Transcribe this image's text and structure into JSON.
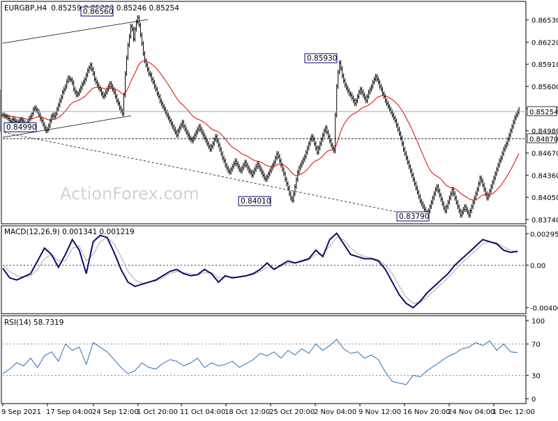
{
  "header": {
    "symbol": "EURGBP,H4",
    "ohlc": "0.85259 0.85303 0.85246 0.85254"
  },
  "watermark": "ActionForex.com",
  "colors": {
    "background": "#ffffff",
    "frame": "#000000",
    "price": "#000000",
    "ma": "#dd0000",
    "macd_main": "#0a0a6e",
    "macd_signal": "#a8a8a8",
    "rsi": "#2b6fb5",
    "label_box": "#000080",
    "watermark": "#d2d2d2"
  },
  "chart_data": [
    {
      "type": "line",
      "name": "price-panel",
      "series_note": "H4 bar chart with moving average",
      "x_labels": [
        "9 Sep 2021",
        "17 Sep 04:00",
        "24 Sep 12:00",
        "1 Oct 20:00",
        "11 Oct 04:00",
        "18 Oct 12:00",
        "25 Oct 20:00",
        "2 Nov 04:00",
        "9 Nov 12:00",
        "16 Nov 20:00",
        "24 Nov 04:00",
        "1 Dec 12:00"
      ],
      "y_ticks": [
        "0.86530",
        "0.86220",
        "0.85910",
        "0.85600",
        "0.85290",
        "0.84980",
        "0.84670",
        "0.84360",
        "0.84050",
        "0.83740"
      ],
      "ylim": [
        0.837,
        0.8675
      ],
      "price_x": [
        0.0,
        2,
        4,
        6,
        8,
        10,
        12,
        14,
        16,
        18,
        20,
        22,
        24,
        26,
        28,
        30,
        32,
        34,
        36,
        38,
        40,
        42,
        44,
        46,
        48,
        50,
        52,
        54,
        56,
        58,
        60,
        62,
        64,
        66,
        68,
        70,
        72,
        74,
        76,
        78,
        80,
        82,
        84,
        86,
        88,
        90,
        92,
        94,
        96,
        98,
        100,
        102,
        104,
        106,
        108,
        110,
        112,
        114,
        116,
        118,
        120,
        122,
        124,
        126,
        128,
        130,
        132,
        134,
        136,
        138,
        140,
        142,
        144,
        146,
        148,
        150,
        152,
        154,
        156,
        158,
        160,
        162,
        164,
        166,
        168,
        170,
        172,
        174,
        176,
        178,
        180,
        182,
        184,
        186,
        188,
        190,
        192,
        194,
        196,
        198,
        200,
        202,
        204,
        206,
        208,
        210,
        212,
        214,
        216,
        218,
        220,
        222,
        224,
        226,
        228,
        230,
        232,
        234,
        236,
        238,
        240,
        242,
        244,
        246,
        248,
        250,
        252,
        254,
        256,
        258,
        260,
        262,
        264,
        266,
        268,
        270,
        272,
        274,
        276,
        278,
        280,
        282,
        284,
        286,
        288,
        290,
        292,
        294,
        296,
        298,
        300,
        302,
        304,
        306,
        308,
        310,
        312,
        314,
        316,
        318,
        320,
        322,
        324,
        326,
        328,
        330,
        332,
        334,
        336,
        338,
        340,
        342,
        344,
        346,
        348,
        350,
        352,
        354,
        356,
        358,
        360,
        362,
        364,
        366,
        368,
        370,
        372,
        374,
        376,
        378,
        380,
        382,
        384,
        386,
        388,
        390,
        392,
        394,
        396,
        398,
        400,
        402,
        404,
        406,
        408,
        410,
        412,
        414,
        416,
        418,
        420,
        422,
        424,
        426,
        428,
        430,
        432,
        434,
        436,
        438,
        440,
        442,
        444,
        446,
        448,
        450,
        452,
        454,
        456,
        458,
        460,
        462,
        464,
        466,
        468,
        470,
        472,
        474,
        476,
        478,
        480,
        482,
        484,
        486,
        488,
        490,
        492,
        494,
        496,
        498,
        500,
        502,
        504,
        506,
        508,
        510,
        512,
        514,
        516,
        518,
        520,
        522,
        524,
        526,
        528,
        530,
        532,
        534,
        536,
        538,
        540,
        542,
        544,
        546,
        548,
        550,
        552,
        554,
        556,
        558,
        560,
        562,
        564,
        566,
        568,
        570,
        572,
        574,
        576,
        578,
        580,
        582,
        584,
        586,
        588,
        590,
        592,
        594,
        596,
        598,
        600,
        602,
        604,
        606,
        608,
        610,
        612,
        614,
        616,
        618,
        620,
        622,
        624,
        626,
        628,
        630,
        632,
        634,
        636,
        638,
        640,
        642,
        644,
        646,
        648,
        650,
        652,
        654,
        656,
        658,
        660,
        662,
        664,
        666,
        668,
        670,
        672,
        674,
        676,
        678,
        680,
        682,
        684,
        686,
        688,
        690,
        692,
        694,
        696,
        698,
        700,
        702,
        704,
        706,
        708,
        710,
        712,
        714,
        716,
        718,
        720,
        722,
        724,
        726,
        728,
        730,
        732,
        734,
        736,
        738,
        740,
        742
      ],
      "price_note": "x values in bar-index units (0-742); mapped to pixels by script",
      "close": [
        0.852,
        0.8519,
        0.8518,
        0.8517,
        0.8515,
        0.8512,
        0.851,
        0.8514,
        0.8513,
        0.8511,
        0.8508,
        0.851,
        0.8512,
        0.8514,
        0.8512,
        0.8509,
        0.8507,
        0.8503,
        0.851,
        0.8515,
        0.8518,
        0.8522,
        0.8528,
        0.853,
        0.8527,
        0.8525,
        0.852,
        0.8515,
        0.8512,
        0.8507,
        0.8502,
        0.8498,
        0.85,
        0.8505,
        0.8512,
        0.8518,
        0.852,
        0.8518,
        0.8522,
        0.8528,
        0.8534,
        0.854,
        0.8545,
        0.8552,
        0.8556,
        0.856,
        0.8567,
        0.8572,
        0.857,
        0.8569,
        0.8565,
        0.8556,
        0.8552,
        0.8548,
        0.855,
        0.8554,
        0.8558,
        0.8563,
        0.8566,
        0.857,
        0.8576,
        0.8582,
        0.8586,
        0.859,
        0.8584,
        0.8578,
        0.857,
        0.8566,
        0.8562,
        0.8558,
        0.8555,
        0.855,
        0.8546,
        0.8548,
        0.8552,
        0.8556,
        0.856,
        0.8564,
        0.856,
        0.8556,
        0.8552,
        0.8546,
        0.854,
        0.8536,
        0.853,
        0.8526,
        0.8522,
        0.8548,
        0.8578,
        0.86,
        0.8618,
        0.863,
        0.8644,
        0.864,
        0.8626,
        0.864,
        0.865,
        0.8656,
        0.8646,
        0.8632,
        0.862,
        0.8606,
        0.8596,
        0.859,
        0.8584,
        0.8578,
        0.8576,
        0.857,
        0.8566,
        0.856,
        0.8556,
        0.855,
        0.8546,
        0.854,
        0.8536,
        0.8532,
        0.8528,
        0.8524,
        0.852,
        0.8516,
        0.8512,
        0.8508,
        0.8504,
        0.85,
        0.8496,
        0.8492,
        0.8498,
        0.8502,
        0.8506,
        0.851,
        0.8504,
        0.85,
        0.8496,
        0.8492,
        0.8488,
        0.8486,
        0.8484,
        0.8488,
        0.8492,
        0.8496,
        0.85,
        0.8504,
        0.85,
        0.8496,
        0.8492,
        0.8488,
        0.8484,
        0.848,
        0.8476,
        0.8472,
        0.8476,
        0.848,
        0.8486,
        0.849,
        0.8484,
        0.8478,
        0.8472,
        0.8466,
        0.846,
        0.8456,
        0.845,
        0.8446,
        0.8442,
        0.844,
        0.8444,
        0.8448,
        0.8452,
        0.8456,
        0.8452,
        0.8448,
        0.8444,
        0.8442,
        0.8446,
        0.845,
        0.8454,
        0.845,
        0.8446,
        0.8442,
        0.844,
        0.8436,
        0.844,
        0.8444,
        0.8448,
        0.8452,
        0.8448,
        0.8444,
        0.844,
        0.8436,
        0.8432,
        0.843,
        0.8434,
        0.8438,
        0.8442,
        0.8446,
        0.845,
        0.8454,
        0.846,
        0.8466,
        0.8462,
        0.8456,
        0.845,
        0.8444,
        0.8438,
        0.843,
        0.8424,
        0.8418,
        0.841,
        0.8404,
        0.8401,
        0.841,
        0.842,
        0.843,
        0.844,
        0.8446,
        0.845,
        0.8454,
        0.8458,
        0.8462,
        0.8468,
        0.8474,
        0.848,
        0.8486,
        0.849,
        0.8486,
        0.848,
        0.8474,
        0.8468,
        0.8474,
        0.848,
        0.8486,
        0.8492,
        0.8498,
        0.8502,
        0.8496,
        0.849,
        0.8484,
        0.8478,
        0.8474,
        0.847,
        0.852,
        0.856,
        0.858,
        0.8593,
        0.8585,
        0.8575,
        0.8568,
        0.8562,
        0.8558,
        0.8554,
        0.855,
        0.8548,
        0.8544,
        0.854,
        0.8536,
        0.854,
        0.8546,
        0.8552,
        0.8556,
        0.8552,
        0.8548,
        0.8544,
        0.854,
        0.8546,
        0.8552,
        0.8556,
        0.856,
        0.8566,
        0.857,
        0.8574,
        0.857,
        0.8566,
        0.856,
        0.8556,
        0.855,
        0.8546,
        0.854,
        0.8536,
        0.8532,
        0.8528,
        0.8524,
        0.852,
        0.8516,
        0.8512,
        0.8506,
        0.85,
        0.8494,
        0.8488,
        0.848,
        0.8472,
        0.8466,
        0.846,
        0.8454,
        0.8448,
        0.8442,
        0.8436,
        0.843,
        0.8424,
        0.8418,
        0.8412,
        0.8406,
        0.84,
        0.8396,
        0.8392,
        0.8388,
        0.8384,
        0.838,
        0.8386,
        0.8392,
        0.8398,
        0.8404,
        0.841,
        0.8416,
        0.842,
        0.8414,
        0.8408,
        0.8402,
        0.8396,
        0.839,
        0.8386,
        0.8392,
        0.8398,
        0.8404,
        0.841,
        0.8416,
        0.841,
        0.8404,
        0.8398,
        0.8392,
        0.8386,
        0.838,
        0.8384,
        0.8388,
        0.8392,
        0.8388,
        0.8384,
        0.838,
        0.8386,
        0.8392,
        0.8398,
        0.8404,
        0.841,
        0.8416,
        0.8424,
        0.8432,
        0.8428,
        0.8422,
        0.8416,
        0.841,
        0.8404,
        0.8408,
        0.8414,
        0.842,
        0.8426,
        0.8432,
        0.8438,
        0.8444,
        0.845,
        0.8456,
        0.846,
        0.8466,
        0.8472,
        0.8476,
        0.848,
        0.8486,
        0.8492,
        0.8498,
        0.8504,
        0.851,
        0.8516,
        0.852,
        0.8524,
        0.8528,
        0.8532,
        0.8536,
        0.854,
        0.8536,
        0.853,
        0.8524,
        0.852,
        0.8516,
        0.8512,
        0.8508,
        0.8504,
        0.85,
        0.8504,
        0.851,
        0.8516,
        0.8522,
        0.8528,
        0.8534,
        0.854,
        0.8546,
        0.8552,
        0.8548,
        0.8544,
        0.854,
        0.8536,
        0.853,
        0.8526,
        0.8525
      ]
    },
    {
      "type": "line",
      "name": "macd-panel",
      "title": "MACD(12,26,9) 0.001341 0.001219",
      "y_ticks": [
        "0.002955",
        "0.00",
        "-0.004009"
      ],
      "ylim": [
        -0.0043,
        0.0033
      ],
      "x": [
        0,
        10,
        20,
        30,
        40,
        50,
        60,
        70,
        80,
        90,
        100,
        110,
        120,
        130,
        140,
        150,
        160,
        170,
        180,
        190,
        200,
        210,
        220,
        230,
        240,
        250,
        260,
        270,
        280,
        290,
        300,
        310,
        320,
        330,
        340,
        350,
        360,
        370,
        380,
        390,
        400,
        410,
        420,
        430,
        440,
        450,
        460,
        470,
        480,
        490,
        500,
        510,
        520,
        530,
        540,
        550,
        560,
        570,
        580,
        590,
        600,
        610,
        620,
        630,
        640,
        650,
        660,
        670,
        680,
        690,
        700,
        710,
        720,
        730,
        740
      ],
      "main": [
        -0.0003,
        -0.0012,
        -0.0014,
        -0.0011,
        -0.0008,
        0.0004,
        0.0016,
        0.001,
        -0.0002,
        0.001,
        0.0024,
        0.0014,
        -0.0008,
        0.0022,
        0.0028,
        0.0026,
        0.0012,
        -0.0004,
        -0.0016,
        -0.002,
        -0.0018,
        -0.0016,
        -0.0014,
        -0.001,
        -0.0006,
        -0.0004,
        -0.0008,
        -0.001,
        -0.0009,
        -0.0004,
        -0.0008,
        -0.0016,
        -0.001,
        -0.0012,
        -0.0011,
        -0.001,
        -0.0008,
        -0.0004,
        0.0002,
        -0.0004,
        0.0,
        0.0004,
        0.0002,
        0.0004,
        0.0006,
        0.0014,
        0.0008,
        0.0024,
        0.003,
        0.002,
        0.001,
        0.0008,
        0.0006,
        0.0006,
        0.0004,
        -0.0004,
        -0.0016,
        -0.0028,
        -0.0036,
        -0.004,
        -0.0034,
        -0.0026,
        -0.002,
        -0.0014,
        -0.0008,
        0.0,
        0.0006,
        0.0012,
        0.0018,
        0.0024,
        0.0022,
        0.002,
        0.0014,
        0.0012,
        0.0013
      ],
      "signal": [
        0.0,
        -0.0006,
        -0.001,
        -0.0011,
        -0.001,
        -0.0004,
        0.0006,
        0.001,
        0.0004,
        0.0004,
        0.0016,
        0.0018,
        0.0004,
        0.001,
        0.0022,
        0.0026,
        0.002,
        0.0008,
        -0.0006,
        -0.0014,
        -0.0017,
        -0.0016,
        -0.0015,
        -0.0012,
        -0.0008,
        -0.0006,
        -0.0007,
        -0.0008,
        -0.0009,
        -0.0007,
        -0.0007,
        -0.0012,
        -0.0011,
        -0.0011,
        -0.0011,
        -0.001,
        -0.0009,
        -0.0006,
        -0.0002,
        -0.0003,
        -0.0001,
        0.0002,
        0.0002,
        0.0003,
        0.0005,
        0.001,
        0.001,
        0.0018,
        0.0026,
        0.0024,
        0.0016,
        0.0011,
        0.0008,
        0.0007,
        0.0005,
        0.0,
        -0.0008,
        -0.002,
        -0.003,
        -0.0036,
        -0.0035,
        -0.003,
        -0.0024,
        -0.0018,
        -0.0012,
        -0.0005,
        0.0002,
        0.0008,
        0.0014,
        0.002,
        0.0022,
        0.0021,
        0.0017,
        0.0014,
        0.0012
      ]
    },
    {
      "type": "line",
      "name": "rsi-panel",
      "title": "RSI(14) 58.7319",
      "y_ticks": [
        "100",
        "70",
        "30",
        "0"
      ],
      "ylim": [
        0,
        100
      ],
      "x": [
        0,
        10,
        20,
        30,
        40,
        50,
        60,
        70,
        80,
        90,
        100,
        110,
        120,
        130,
        140,
        150,
        160,
        170,
        180,
        190,
        200,
        210,
        220,
        230,
        240,
        250,
        260,
        270,
        280,
        290,
        300,
        310,
        320,
        330,
        340,
        350,
        360,
        370,
        380,
        390,
        400,
        410,
        420,
        430,
        440,
        450,
        460,
        470,
        480,
        490,
        500,
        510,
        520,
        530,
        540,
        550,
        560,
        570,
        580,
        590,
        600,
        610,
        620,
        630,
        640,
        650,
        660,
        670,
        680,
        690,
        700,
        710,
        720,
        730,
        740
      ],
      "values": [
        32,
        38,
        46,
        42,
        52,
        40,
        55,
        60,
        48,
        70,
        62,
        66,
        44,
        72,
        66,
        60,
        50,
        40,
        32,
        36,
        46,
        40,
        38,
        45,
        50,
        48,
        42,
        46,
        52,
        40,
        46,
        42,
        44,
        48,
        40,
        45,
        50,
        58,
        55,
        60,
        52,
        62,
        56,
        64,
        58,
        70,
        62,
        68,
        76,
        64,
        58,
        60,
        52,
        56,
        50,
        34,
        22,
        20,
        18,
        30,
        28,
        36,
        42,
        48,
        54,
        58,
        64,
        66,
        72,
        68,
        74,
        62,
        70,
        60,
        59
      ],
      "levels": [
        70,
        30
      ]
    }
  ],
  "annotations": {
    "labels": [
      "0.86560",
      "0.84990",
      "0.85930",
      "0.84010",
      "0.83790"
    ],
    "current_price": "0.85254",
    "support_level": "0.84870",
    "support_value": 0.8487
  }
}
